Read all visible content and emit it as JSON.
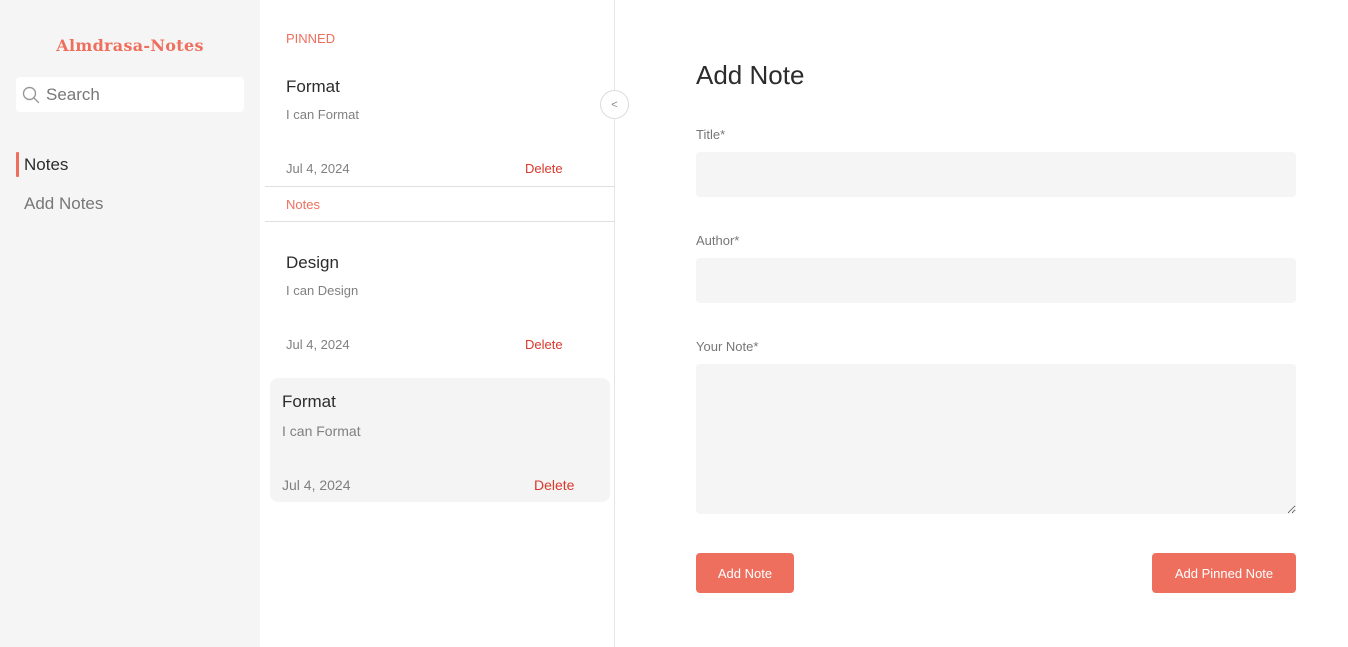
{
  "colors": {
    "accent": "#ee6f5d",
    "delete": "#d9382a",
    "sidebar_bg": "#f5f5f5",
    "field_bg": "#f5f5f5"
  },
  "sidebar": {
    "brand": "Almdrasa-Notes",
    "search_placeholder": "Search",
    "search_icon": "search-icon",
    "nav": [
      {
        "label": "Notes",
        "active": true
      },
      {
        "label": "Add Notes",
        "active": false
      }
    ]
  },
  "list": {
    "pinned_label": "PINNED",
    "notes_label": "Notes",
    "collapse_label": "<",
    "pinned": [
      {
        "title": "Format",
        "desc": "I can Format",
        "date": "Jul 4, 2024",
        "delete_label": "Delete"
      }
    ],
    "notes": [
      {
        "title": "Design",
        "desc": "I can Design",
        "date": "Jul 4, 2024",
        "delete_label": "Delete"
      },
      {
        "title": "Format",
        "desc": "I can Format",
        "date": "Jul 4, 2024",
        "delete_label": "Delete"
      }
    ]
  },
  "form": {
    "heading": "Add Note",
    "title_label": "Title*",
    "author_label": "Author*",
    "note_label": "Your Note*",
    "add_button": "Add Note",
    "add_pinned_button": "Add Pinned Note"
  }
}
